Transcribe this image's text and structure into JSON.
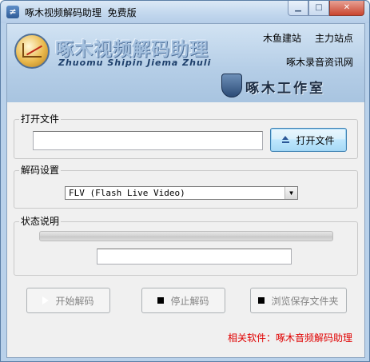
{
  "window": {
    "title": "啄木视频解码助理  免费版",
    "icon": "app-icon",
    "buttons": {
      "minimize": "minimize-icon",
      "maximize": "maximize-icon",
      "close": "close-icon"
    }
  },
  "banner": {
    "logo_title": "啄木视频解码助理",
    "logo_pinyin": "Zhuomu  Shipin  Jiema  Zhuli",
    "links": [
      "木鱼建站",
      "主力站点",
      "啄木录音资讯网"
    ],
    "studio": "啄木工作室"
  },
  "open_file": {
    "group_label": "打开文件",
    "path_value": "",
    "button_label": "打开文件",
    "button_icon": "eject-icon"
  },
  "decode_settings": {
    "group_label": "解码设置",
    "selected_format": "FLV (Flash Live Video)"
  },
  "status": {
    "group_label": "状态说明",
    "progress": 0,
    "status_text": ""
  },
  "actions": {
    "start_label": "开始解码",
    "stop_label": "停止解码",
    "browse_label": "浏览保存文件夹"
  },
  "footer": {
    "related_text": "相关软件：啄木音频解码助理"
  },
  "colors": {
    "title_bar": "#c3d8ee",
    "banner": "#b4cde6",
    "related_link": "#e00000",
    "focus_button": "#3c7fb1"
  }
}
